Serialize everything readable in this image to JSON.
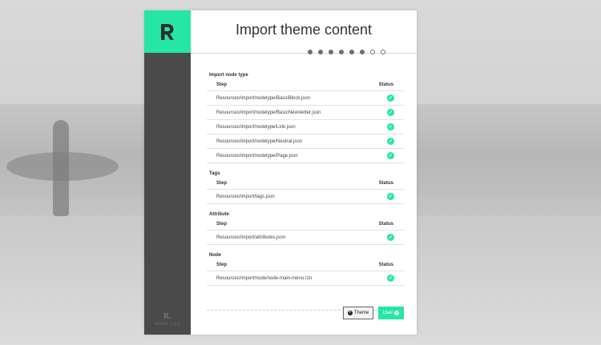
{
  "header": {
    "title": "Import theme content"
  },
  "progress": {
    "total_steps": 8,
    "completed_steps": 6
  },
  "sidebar": {
    "mark": "R.",
    "version": "Roadiz 1.2.0"
  },
  "colors": {
    "accent": "#26e6a6",
    "sidebar": "#4a4a4a"
  },
  "sections": [
    {
      "title": "Import node type",
      "col_step": "Step",
      "col_status": "Status",
      "rows": [
        "Resources/import/nodetype/BasicBlock.json",
        "Resources/import/nodetype/BasicNewsletter.json",
        "Resources/import/nodetype/Link.json",
        "Resources/import/nodetype/Neutral.json",
        "Resources/import/nodetype/Page.json"
      ]
    },
    {
      "title": "Tags",
      "col_step": "Step",
      "col_status": "Status",
      "rows": [
        "Resources/import/tags.json"
      ]
    },
    {
      "title": "Attribute",
      "col_step": "Step",
      "col_status": "Status",
      "rows": [
        "Resources/import/attributes.json"
      ]
    },
    {
      "title": "Node",
      "col_step": "Step",
      "col_status": "Status",
      "rows": [
        "Resources/import/node/node-main-menu.rzn"
      ]
    }
  ],
  "buttons": {
    "theme": "Theme",
    "user": "User"
  },
  "icons": {
    "status": "check-icon",
    "theme": "plus-circle-icon",
    "user": "arrow-circle-right-icon"
  }
}
